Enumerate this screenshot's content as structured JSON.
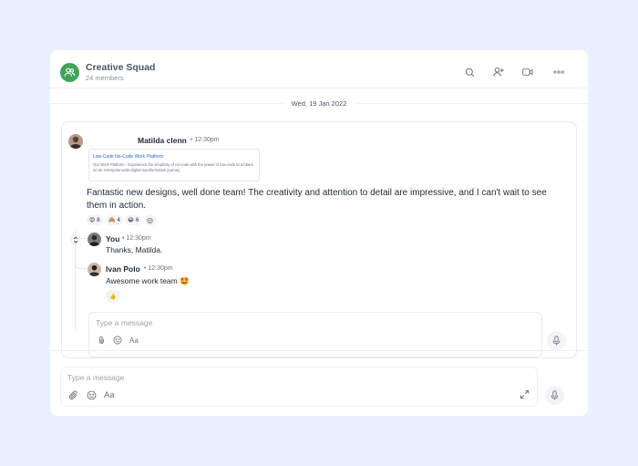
{
  "header": {
    "group_name": "Creative Squad",
    "members": "24 members",
    "actions": [
      "search-icon",
      "add-user-icon",
      "video-icon",
      "more-icon"
    ]
  },
  "date_divider": "Wed, 19 Jan 2022",
  "message": {
    "author": "Matilda clenn",
    "time": "• 12:30pm",
    "link_preview": {
      "title": "Low-Code No-Code Work Platform",
      "description": "Our Work Platform - Experience the simplicity of no-code with the power of low-code to embark on an enterprise-wide digital transformation journey"
    },
    "text": "Fantastic new designs, well done team! The creativity and attention to detail are impressive, and I can't wait to see them in action.",
    "reactions": [
      {
        "emoji": "😍",
        "count": "8"
      },
      {
        "emoji": "🙈",
        "count": "4"
      },
      {
        "emoji": "😂",
        "count": "6"
      }
    ]
  },
  "replies": [
    {
      "author": "You",
      "time": "• 12:30pm",
      "text": "Thanks, Matilda."
    },
    {
      "author": "Ivan Polo",
      "time": "• 12:30pm",
      "text": "Awesome work team 🤩",
      "reaction": "👍"
    }
  ],
  "thread_input": {
    "placeholder": "Type a message",
    "format_label": "Aa"
  },
  "main_input": {
    "placeholder": "Type a message",
    "format_label": "Aa"
  },
  "colors": {
    "accent": "#3fa45a",
    "background": "#eaf1fd",
    "link": "#2563eb"
  }
}
